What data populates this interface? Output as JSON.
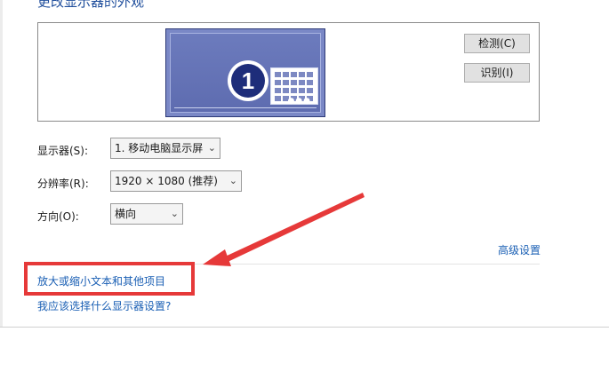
{
  "header": {
    "title": "更改显示器的外观"
  },
  "preview": {
    "monitor_number": "1",
    "detect_button": "检测(C)",
    "identify_button": "识别(I)"
  },
  "settings": {
    "display_label": "显示器(S):",
    "display_value": "1. 移动电脑显示屏",
    "resolution_label": "分辨率(R):",
    "resolution_value": "1920 × 1080 (推荐)",
    "orientation_label": "方向(O):",
    "orientation_value": "横向"
  },
  "links": {
    "advanced": "高级设置",
    "text_size": "放大或缩小文本和其他项目",
    "help": "我应该选择什么显示器设置?"
  },
  "annotation": {
    "color": "#e63939"
  }
}
